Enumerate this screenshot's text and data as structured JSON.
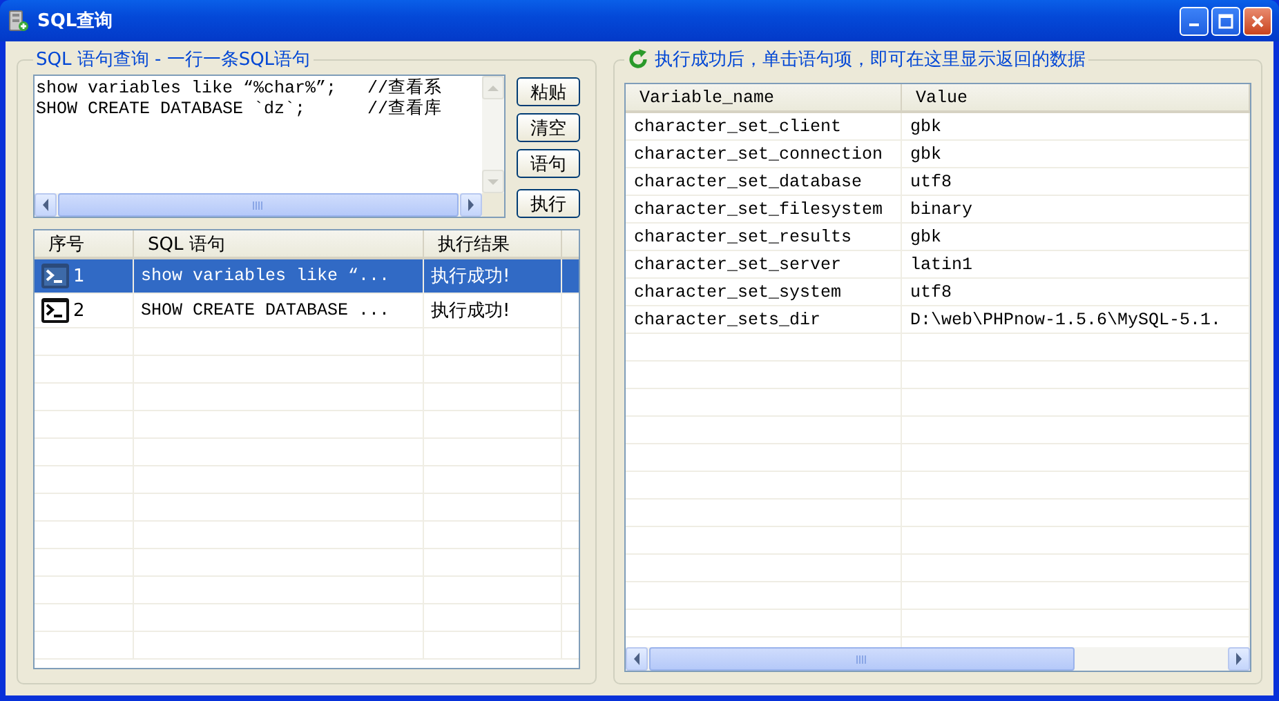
{
  "window": {
    "title": "SQL查询"
  },
  "query_panel": {
    "title": "SQL 语句查询 - 一行一条SQL语句",
    "editor": {
      "lines": [
        "show variables like “%char%”;   //查看系",
        "SHOW CREATE DATABASE `dz`;      //查看库"
      ]
    },
    "buttons": [
      "粘贴",
      "清空",
      "语句",
      "执行"
    ],
    "history": {
      "columns": [
        "序号",
        "SQL 语句",
        "执行结果"
      ],
      "rows": [
        {
          "number": "1",
          "sql": "show variables like “...",
          "result": "执行成功!",
          "selected": true
        },
        {
          "number": "2",
          "sql": "SHOW CREATE DATABASE ...",
          "result": "执行成功!",
          "selected": false
        }
      ]
    }
  },
  "result_panel": {
    "title": "执行成功后，单击语句项，即可在这里显示返回的数据",
    "table": {
      "columns": [
        "Variable_name",
        "Value"
      ],
      "rows": [
        [
          "character_set_client",
          "gbk"
        ],
        [
          "character_set_connection",
          "gbk"
        ],
        [
          "character_set_database",
          "utf8"
        ],
        [
          "character_set_filesystem",
          "binary"
        ],
        [
          "character_set_results",
          "gbk"
        ],
        [
          "character_set_server",
          "latin1"
        ],
        [
          "character_set_system",
          "utf8"
        ],
        [
          "character_sets_dir",
          "D:\\web\\PHPnow-1.5.6\\MySQL-5.1."
        ]
      ]
    }
  }
}
